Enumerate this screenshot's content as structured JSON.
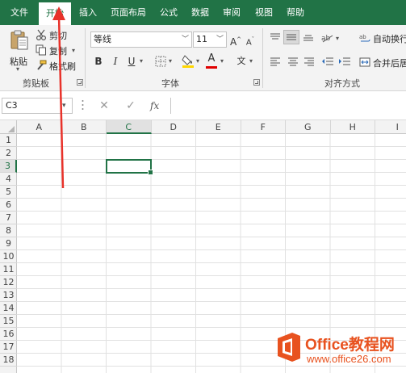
{
  "menu": {
    "items": [
      {
        "label": "文件",
        "active": false
      },
      {
        "label": "开始",
        "active": true
      },
      {
        "label": "插入",
        "active": false
      },
      {
        "label": "页面布局",
        "active": false
      },
      {
        "label": "公式",
        "active": false
      },
      {
        "label": "数据",
        "active": false
      },
      {
        "label": "审阅",
        "active": false
      },
      {
        "label": "视图",
        "active": false
      },
      {
        "label": "帮助",
        "active": false
      }
    ]
  },
  "ribbon": {
    "clipboard": {
      "group_label": "剪贴板",
      "paste_label": "粘贴",
      "cut_label": "剪切",
      "copy_label": "复制",
      "format_painter_label": "格式刷"
    },
    "font": {
      "group_label": "字体",
      "font_name": "等线",
      "font_size": "11",
      "grow_label": "A",
      "shrink_label": "A",
      "bold_label": "B",
      "italic_label": "I",
      "underline_label": "U",
      "font_color_letter": "A",
      "phonetic_label": "文",
      "fill_color": "#ffd700",
      "font_color": "#e00000"
    },
    "alignment": {
      "group_label": "对齐方式",
      "wrap_text_label": "自动换行",
      "merge_label": "合并后居"
    }
  },
  "formula_bar": {
    "name_box": "C3",
    "fx_label": "fx",
    "cancel_symbol": "✕",
    "enter_symbol": "✓",
    "formula_value": ""
  },
  "sheet": {
    "columns": [
      "A",
      "B",
      "C",
      "D",
      "E",
      "F",
      "G",
      "H",
      "I"
    ],
    "selected_column": "C",
    "rows": [
      "1",
      "2",
      "3",
      "4",
      "5",
      "6",
      "7",
      "8",
      "9",
      "10",
      "11",
      "12",
      "13",
      "14",
      "15",
      "16",
      "17",
      "18"
    ],
    "selected_row": "3",
    "active_cell": "C3"
  },
  "watermark": {
    "name": "Office教程网",
    "url": "www.office26.com"
  },
  "colors": {
    "accent": "#217346",
    "arrow": "#e8322a",
    "logo": "#e8521f"
  }
}
